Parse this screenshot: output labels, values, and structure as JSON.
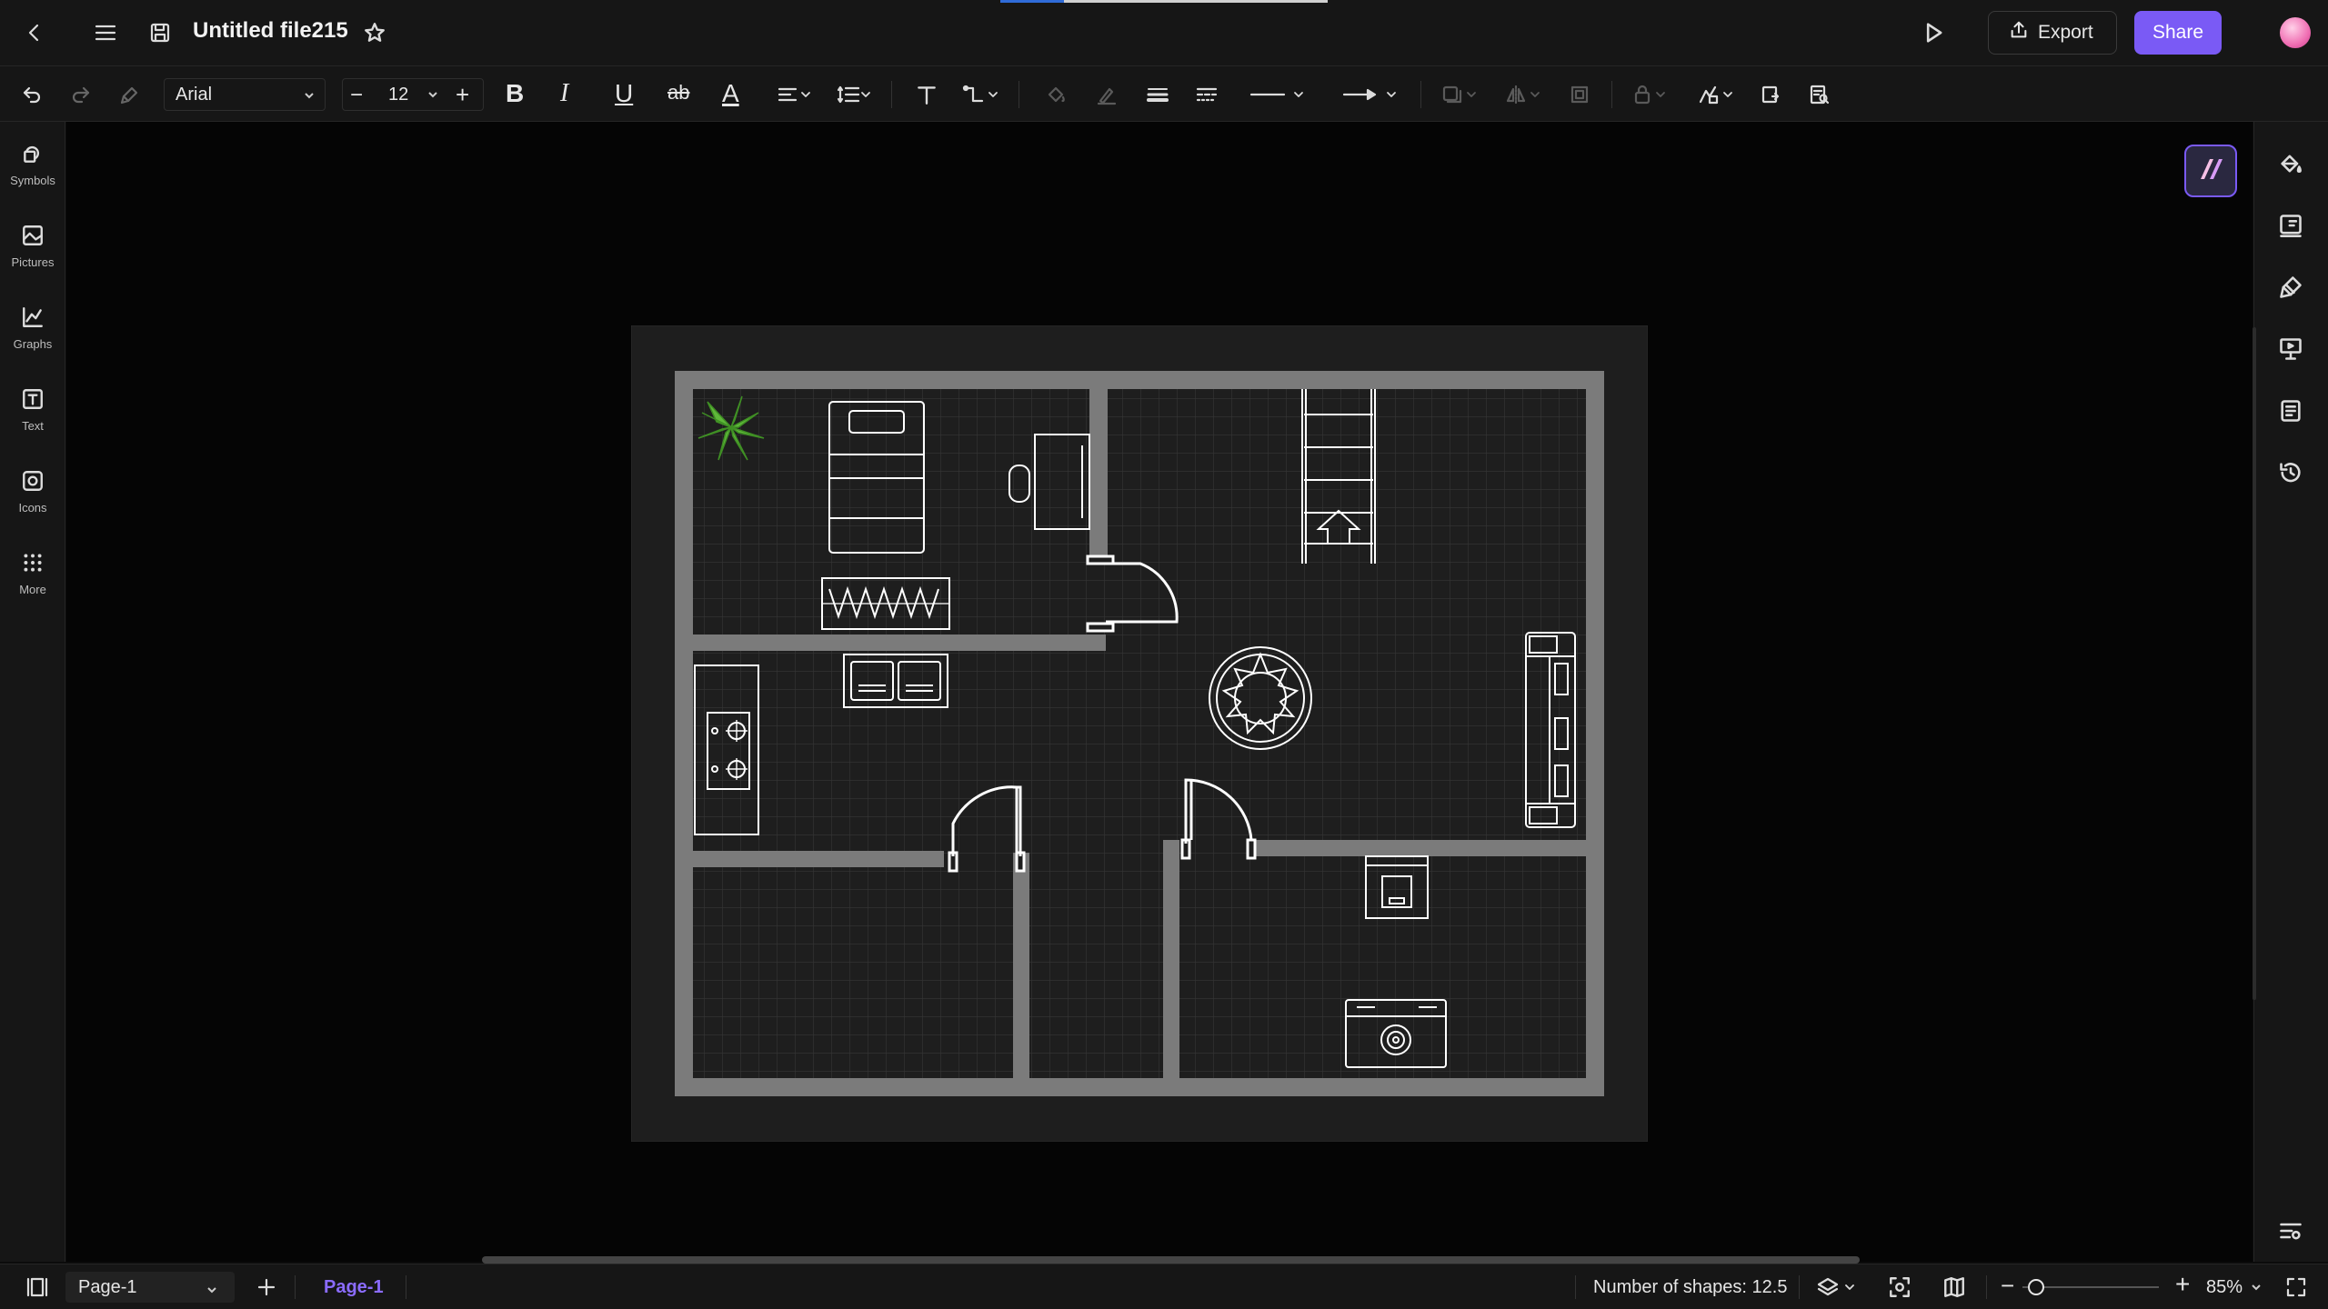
{
  "header": {
    "file_title": "Untitled file215",
    "export_label": "Export",
    "share_label": "Share",
    "accent_color": "#7a5af5"
  },
  "toolbar": {
    "font_family": "Arial",
    "font_size": "12",
    "strikethrough_label": "ab",
    "bold_label": "B",
    "italic_label": "I",
    "underline_label": "U",
    "text_color_label": "A"
  },
  "left_sidebar": {
    "items": [
      {
        "label": "Symbols",
        "icon": "symbols-icon"
      },
      {
        "label": "Pictures",
        "icon": "pictures-icon"
      },
      {
        "label": "Graphs",
        "icon": "graphs-icon"
      },
      {
        "label": "Text",
        "icon": "text-icon"
      },
      {
        "label": "Icons",
        "icon": "icons-icon"
      },
      {
        "label": "More",
        "icon": "more-icon"
      }
    ]
  },
  "right_sidebar": {
    "icons": [
      "fill-style-icon",
      "format-icon",
      "paint-icon",
      "presentation-icon",
      "page-setup-icon",
      "history-icon",
      "settings-icon"
    ]
  },
  "statusbar": {
    "page_select": "Page-1",
    "page_tab": "Page-1",
    "shapes_label": "Number of shapes: 12.5",
    "zoom": "85%",
    "zoom_level": 0.1
  },
  "floorplan": {
    "background": "#1e1e1e",
    "wall_color": "#7b7b7b",
    "grid_color": "#3a3a3a",
    "plant_color": "#5fb83a"
  }
}
